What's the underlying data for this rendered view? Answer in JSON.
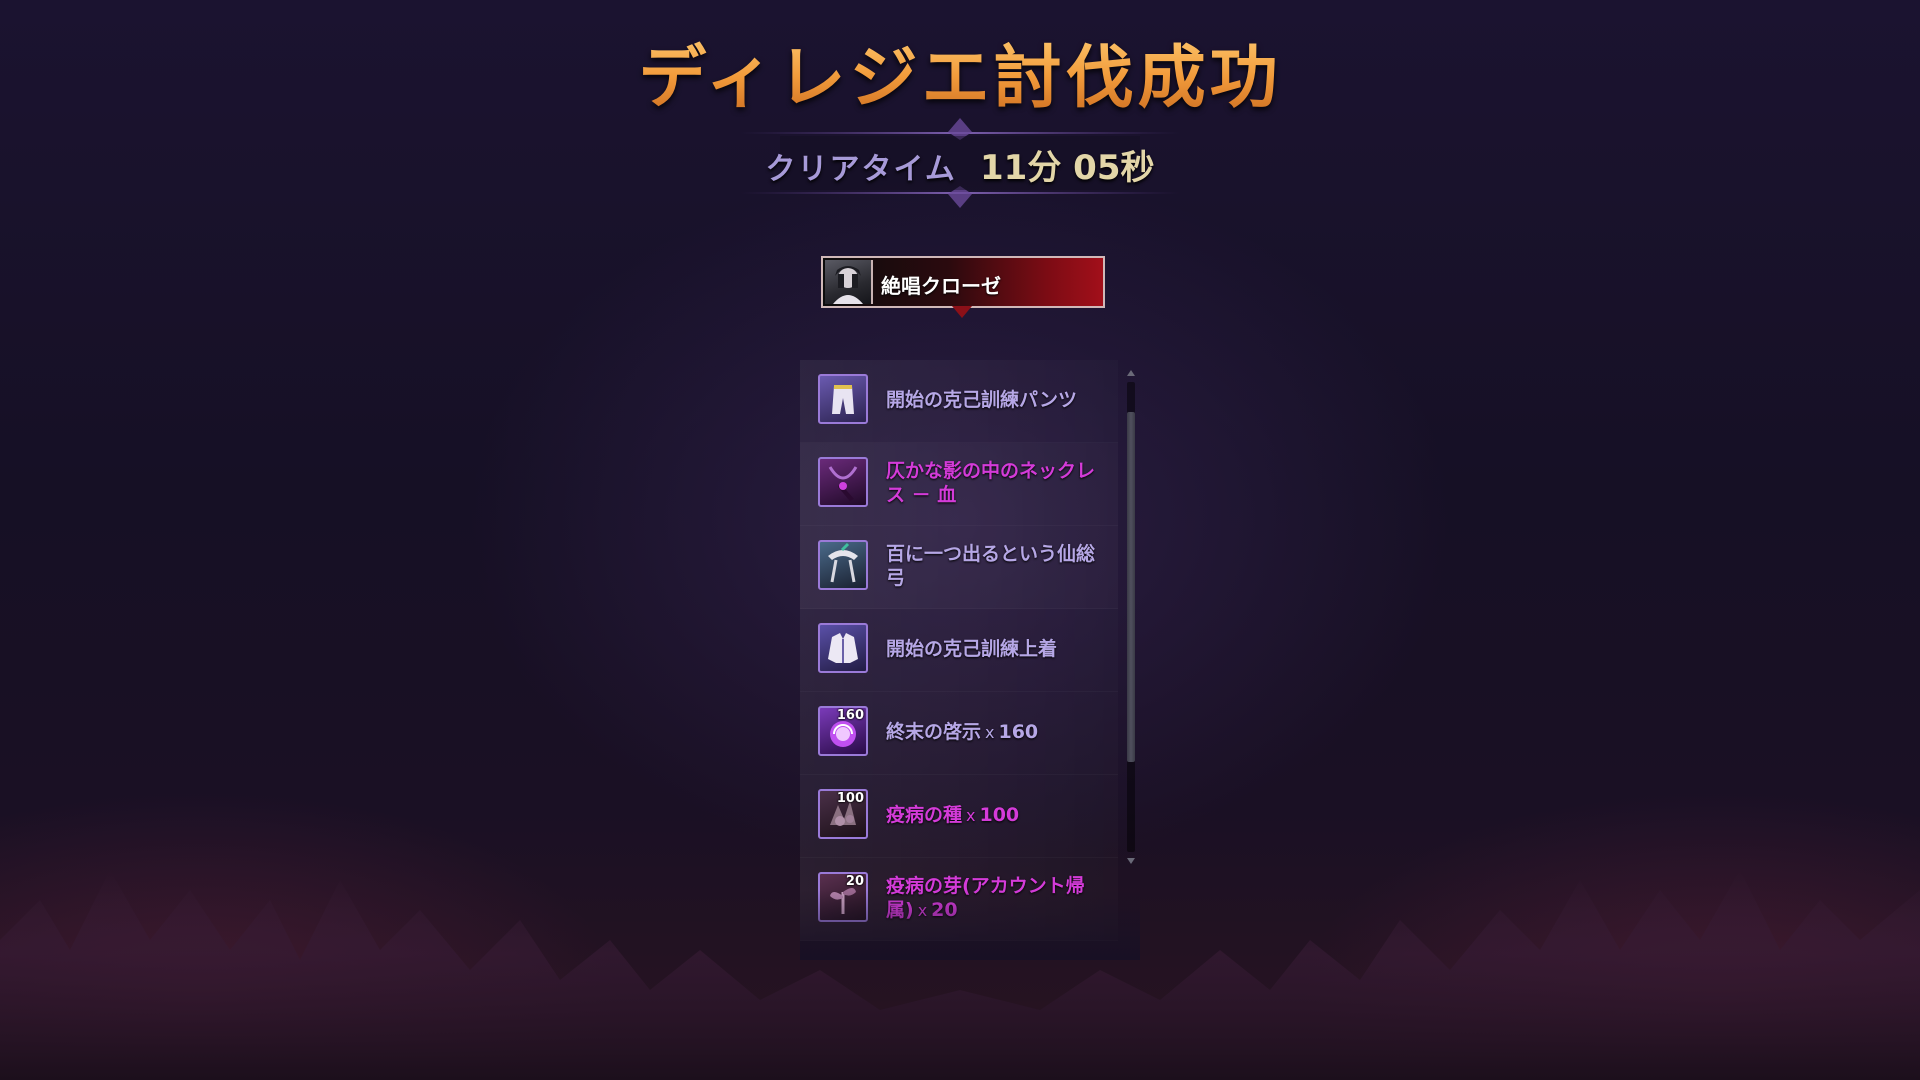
{
  "result": {
    "title": "ディレジエ討伐成功",
    "clear_time_label": "クリアタイム",
    "clear_time_value": "11分 05秒"
  },
  "character": {
    "name": "絶唱クローゼ"
  },
  "rewards": [
    {
      "name": "開始の克己訓練パンツ",
      "quantity": "",
      "rarity": "unique",
      "icon": "pants-icon"
    },
    {
      "name": "仄かな影の中のネックレス － 血",
      "quantity": "",
      "rarity": "epic",
      "icon": "necklace-icon"
    },
    {
      "name": "百に一つ出るという仙総弓",
      "quantity": "",
      "rarity": "unique",
      "icon": "bow-icon"
    },
    {
      "name": "開始の克己訓練上着",
      "quantity": "",
      "rarity": "unique",
      "icon": "jacket-icon"
    },
    {
      "name": "終末の啓示",
      "quantity": "160",
      "rarity": "unique",
      "icon": "orb-icon"
    },
    {
      "name": "疫病の種",
      "quantity": "100",
      "rarity": "epic",
      "icon": "seed-icon"
    },
    {
      "name": "疫病の芽(アカウント帰属)",
      "quantity": "20",
      "rarity": "epic",
      "icon": "sprout-icon"
    }
  ],
  "colors": {
    "title": "#f0a64a",
    "unique_item": "#b6a7e6",
    "epic_item": "#d43bd9",
    "character_tab": "#a20f1a"
  }
}
